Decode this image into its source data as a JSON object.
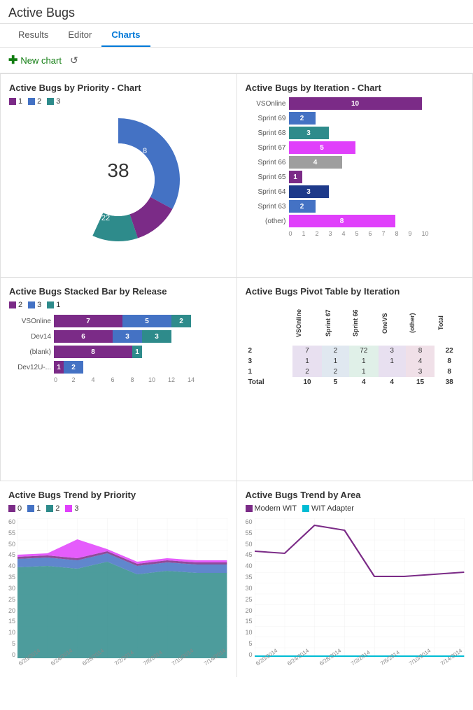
{
  "page": {
    "title": "Active Bugs",
    "tabs": [
      {
        "label": "Results",
        "active": false
      },
      {
        "label": "Editor",
        "active": false
      },
      {
        "label": "Charts",
        "active": true
      }
    ],
    "toolbar": {
      "new_chart_label": "New chart",
      "refresh_title": "Refresh"
    }
  },
  "charts": {
    "priority_chart": {
      "title": "Active Bugs by Priority - Chart",
      "legend": [
        {
          "label": "1",
          "color": "#7B2B87"
        },
        {
          "label": "2",
          "color": "#4472C4"
        },
        {
          "label": "3",
          "color": "#2E8B8B"
        }
      ],
      "total": "38",
      "segments": [
        {
          "label": "1",
          "value": 8,
          "color": "#7B2B87"
        },
        {
          "label": "2",
          "value": 22,
          "color": "#4472C4"
        },
        {
          "label": "3",
          "value": 8,
          "color": "#2E8B8B"
        }
      ]
    },
    "iteration_chart": {
      "title": "Active Bugs by Iteration - Chart",
      "rows": [
        {
          "label": "VSOnline",
          "value": 10,
          "color": "#7B2B87"
        },
        {
          "label": "Sprint 69",
          "value": 2,
          "color": "#4472C4"
        },
        {
          "label": "Sprint 68",
          "value": 3,
          "color": "#2E8B8B"
        },
        {
          "label": "Sprint 67",
          "value": 5,
          "color": "#E040FB"
        },
        {
          "label": "Sprint 66",
          "value": 4,
          "color": "#9E9E9E"
        },
        {
          "label": "Sprint 65",
          "value": 1,
          "color": "#7B2B87"
        },
        {
          "label": "Sprint 64",
          "value": 3,
          "color": "#1E3A8A"
        },
        {
          "label": "Sprint 63",
          "value": 2,
          "color": "#4472C4"
        },
        {
          "label": "(other)",
          "value": 8,
          "color": "#E040FB"
        }
      ],
      "axis_max": 10,
      "axis_ticks": [
        0,
        1,
        2,
        3,
        4,
        5,
        6,
        7,
        8,
        9,
        10
      ]
    },
    "stacked_bar": {
      "title": "Active Bugs Stacked Bar by Release",
      "legend": [
        {
          "label": "2",
          "color": "#7B2B87"
        },
        {
          "label": "3",
          "color": "#4472C4"
        },
        {
          "label": "1",
          "color": "#2E8B8B"
        }
      ],
      "rows": [
        {
          "label": "VSOnline",
          "segments": [
            {
              "v": 7,
              "c": "#7B2B87"
            },
            {
              "v": 5,
              "c": "#4472C4"
            },
            {
              "v": 2,
              "c": "#2E8B8B"
            }
          ]
        },
        {
          "label": "Dev14",
          "segments": [
            {
              "v": 6,
              "c": "#7B2B87"
            },
            {
              "v": 3,
              "c": "#4472C4"
            },
            {
              "v": 3,
              "c": "#2E8B8B"
            }
          ]
        },
        {
          "label": "(blank)",
          "segments": [
            {
              "v": 8,
              "c": "#7B2B87"
            },
            {
              "v": 0,
              "c": "#4472C4"
            },
            {
              "v": 1,
              "c": "#2E8B8B"
            }
          ]
        },
        {
          "label": "Dev12U-...",
          "segments": [
            {
              "v": 1,
              "c": "#7B2B87"
            },
            {
              "v": 2,
              "c": "#4472C4"
            },
            {
              "v": 0,
              "c": "#2E8B8B"
            }
          ]
        }
      ],
      "axis_ticks": [
        0,
        2,
        4,
        6,
        8,
        10,
        12,
        14
      ]
    },
    "pivot_table": {
      "title": "Active Bugs Pivot Table by Iteration",
      "columns": [
        "VSOnline",
        "Sprint 67",
        "Sprint 66",
        "OneVS",
        "(other)",
        "Total"
      ],
      "rows": [
        {
          "label": "2",
          "cells": [
            "7",
            "2",
            "72",
            "3",
            "8",
            "22"
          ]
        },
        {
          "label": "3",
          "cells": [
            "1",
            "1",
            "1",
            "1",
            "4",
            "8"
          ]
        },
        {
          "label": "1",
          "cells": [
            "2",
            "2",
            "1",
            "",
            "3",
            "8"
          ]
        },
        {
          "label": "Total",
          "cells": [
            "10",
            "5",
            "4",
            "4",
            "15",
            "38"
          ]
        }
      ]
    },
    "trend_priority": {
      "title": "Active Bugs Trend by Priority",
      "legend": [
        {
          "label": "0",
          "color": "#7B2B87"
        },
        {
          "label": "1",
          "color": "#4472C4"
        },
        {
          "label": "2",
          "color": "#2E8B8B"
        },
        {
          "label": "3",
          "color": "#E040FB"
        }
      ],
      "y_ticks": [
        "60",
        "55",
        "50",
        "45",
        "40",
        "35",
        "30",
        "25",
        "20",
        "15",
        "10",
        "5",
        "0"
      ],
      "x_labels": [
        "6/20/2014",
        "6/24/2014",
        "6/28/2014",
        "7/2/2014",
        "7/6/2014",
        "7/10/2014",
        "7/14/2014"
      ]
    },
    "trend_area": {
      "title": "Active Bugs Trend by Area",
      "legend": [
        {
          "label": "Modern WIT",
          "color": "#7B2B87"
        },
        {
          "label": "WIT Adapter",
          "color": "#00BCD4"
        }
      ],
      "y_ticks": [
        "60",
        "55",
        "50",
        "45",
        "40",
        "35",
        "30",
        "25",
        "20",
        "15",
        "10",
        "5",
        "0"
      ],
      "x_labels": [
        "6/20/2014",
        "6/24/2014",
        "6/28/2014",
        "7/2/2014",
        "7/6/2014",
        "7/10/2014",
        "7/14/2014"
      ]
    }
  }
}
